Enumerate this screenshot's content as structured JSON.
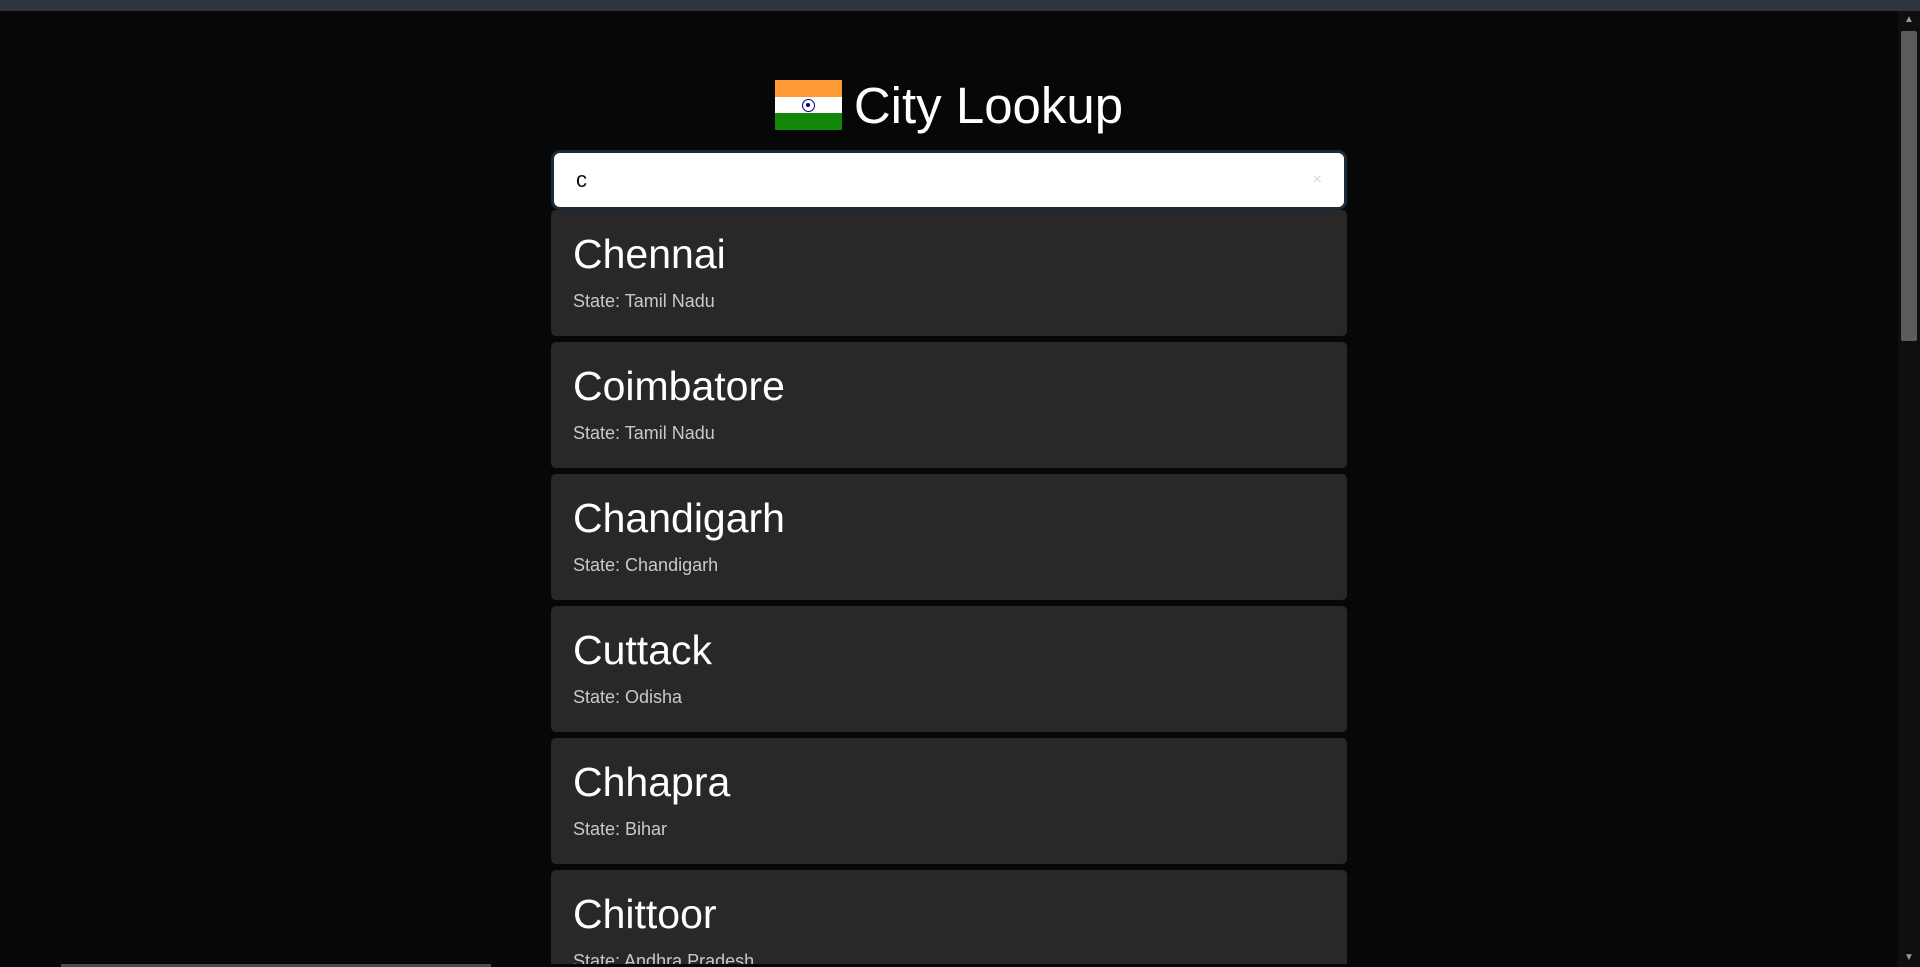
{
  "app": {
    "title": "City Lookup",
    "flag_icon": "india-flag-icon"
  },
  "search": {
    "value": "c",
    "placeholder": "",
    "clear_icon": "×"
  },
  "results": [
    {
      "name": "Chennai",
      "state": "State: Tamil Nadu"
    },
    {
      "name": "Coimbatore",
      "state": "State: Tamil Nadu"
    },
    {
      "name": "Chandigarh",
      "state": "State: Chandigarh"
    },
    {
      "name": "Cuttack",
      "state": "State: Odisha"
    },
    {
      "name": "Chhapra",
      "state": "State: Bihar"
    },
    {
      "name": "Chittoor",
      "state": "State: Andhra Pradesh"
    }
  ],
  "colors": {
    "background": "#070707",
    "card": "#282828",
    "saffron": "#ff9933",
    "green": "#138808",
    "chakra": "#000080"
  },
  "scrollbar": {
    "up_icon": "▲",
    "down_icon": "▼"
  }
}
